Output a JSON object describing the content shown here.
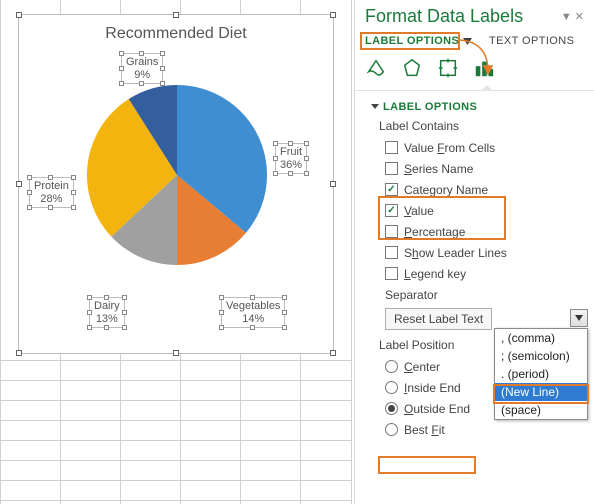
{
  "panel": {
    "title": "Format Data Labels",
    "tabs": {
      "label_options": "LABEL OPTIONS",
      "text_options": "TEXT OPTIONS"
    },
    "section": "LABEL OPTIONS",
    "label_contains": "Label Contains",
    "opts": {
      "value_from_cells": "Value From Cells",
      "series_name": "Series Name",
      "category_name": "Category Name",
      "value": "Value",
      "percentage": "Percentage",
      "show_leader": "Show Leader Lines",
      "legend_key": "Legend key"
    },
    "separator": "Separator",
    "reset": "Reset Label Text",
    "label_position": "Label Position",
    "pos": {
      "center": "Center",
      "inside": "Inside End",
      "outside": "Outside End",
      "best": "Best Fit"
    },
    "dropdown": {
      "comma": ", (comma)",
      "semicolon": "; (semicolon)",
      "period": ". (period)",
      "newline": "(New Line)",
      "space": "  (space)"
    }
  },
  "chart_data": {
    "type": "pie",
    "title": "Recommended Diet",
    "categories": [
      "Fruit",
      "Vegetables",
      "Dairy",
      "Protein",
      "Grains"
    ],
    "values": [
      36,
      14,
      13,
      28,
      9
    ],
    "label_format": "category_newline_percent",
    "colors": [
      "#3f8ed1",
      "#e77e33",
      "#a0a0a0",
      "#f4b40f",
      "#335f9e"
    ],
    "labels": {
      "fruit": {
        "l1": "Fruit",
        "l2": "36%"
      },
      "veg": {
        "l1": "Vegetables",
        "l2": "14%"
      },
      "dairy": {
        "l1": "Dairy",
        "l2": "13%"
      },
      "protein": {
        "l1": "Protein",
        "l2": "28%"
      },
      "grains": {
        "l1": "Grains",
        "l2": "9%"
      }
    }
  }
}
